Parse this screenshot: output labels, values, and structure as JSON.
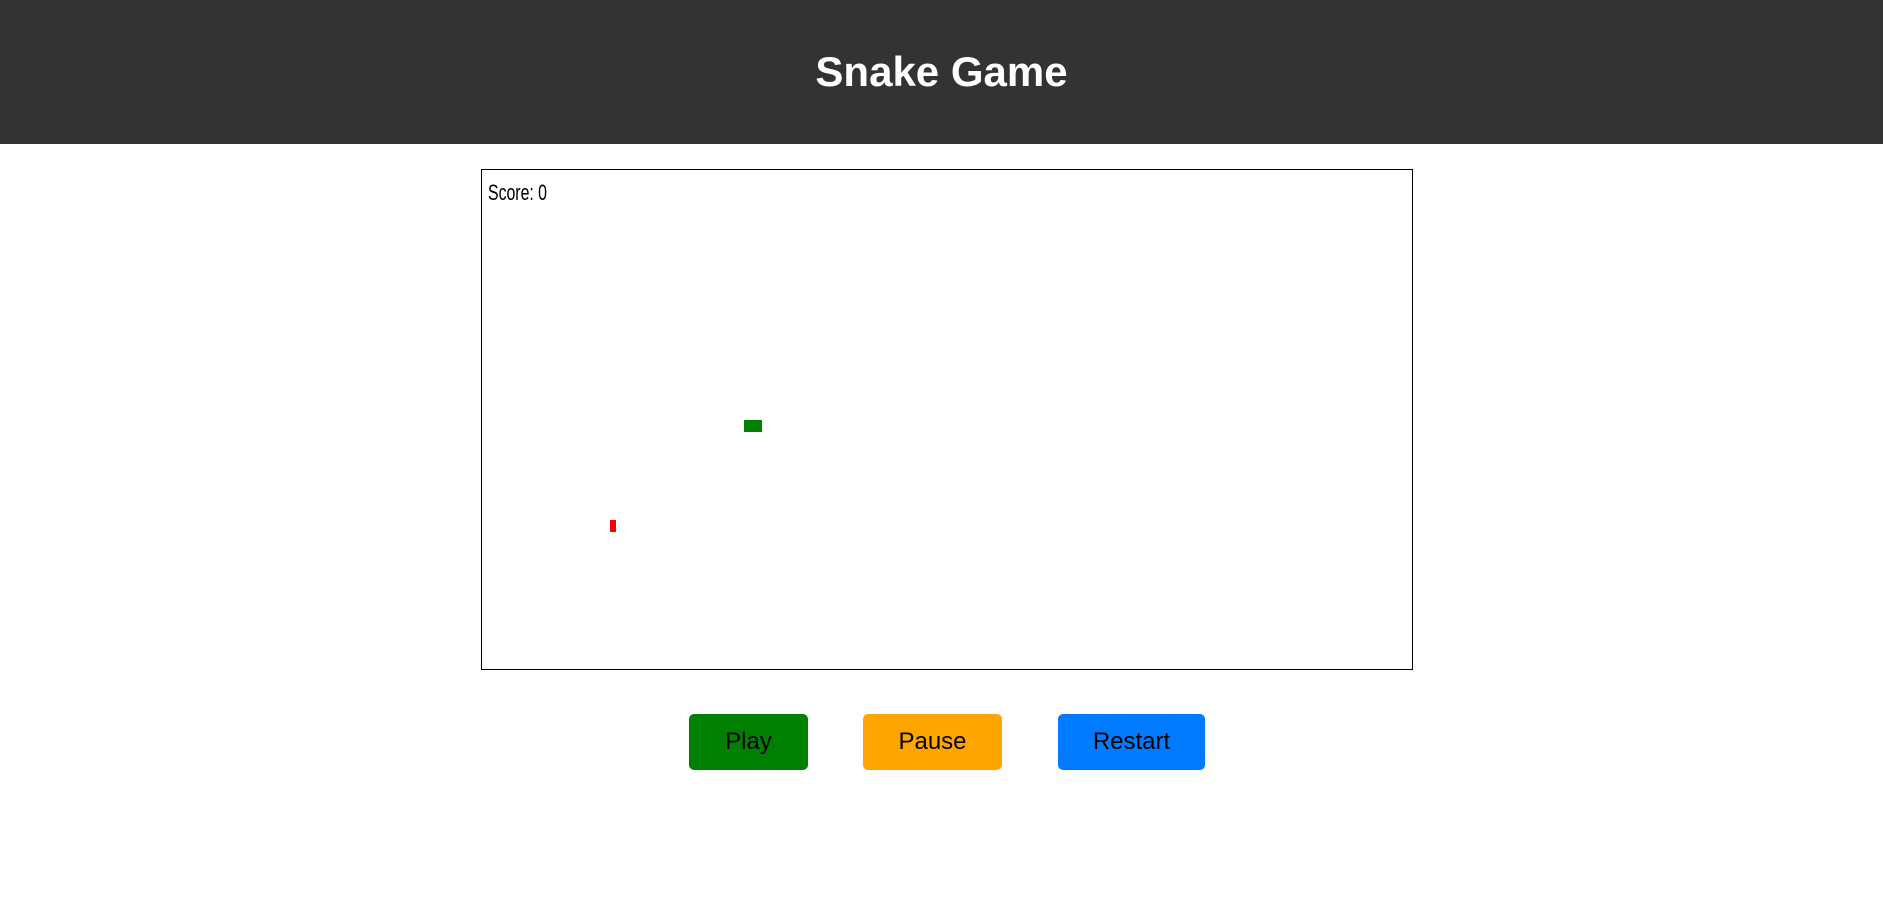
{
  "header": {
    "title": "Snake Game"
  },
  "game": {
    "score_text": "Score: 0",
    "score": 0,
    "snake_color": "#008000",
    "food_color": "#ff0000"
  },
  "controls": {
    "play_label": "Play",
    "pause_label": "Pause",
    "restart_label": "Restart",
    "play_color": "#008000",
    "pause_color": "#ffa500",
    "restart_color": "#007bff"
  }
}
